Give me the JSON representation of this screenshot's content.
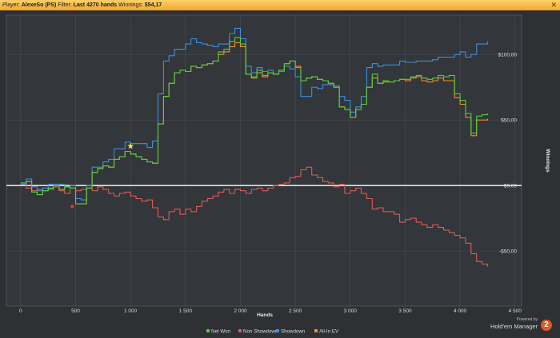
{
  "header": {
    "player_label": "Player:",
    "player_name": "AlexeSo (PS)",
    "filter_label": "Filter:",
    "filter_value": "Last 4270 hands",
    "winnings_label": "Winnings:",
    "winnings_value": "$54,17",
    "close_glyph": "✕"
  },
  "brand": {
    "powered_by": "Powered by",
    "name": "Hold'em Manager",
    "version": "2"
  },
  "chart_data": {
    "type": "line",
    "xlabel": "Hands",
    "ylabel": "Winnings",
    "xlim": [
      -130,
      4560
    ],
    "ylim": [
      -92,
      130
    ],
    "x_ticks": [
      0,
      500,
      1000,
      1500,
      2000,
      2500,
      3000,
      3500,
      4000,
      4500
    ],
    "x_tick_labels": [
      "0",
      "500",
      "1 000",
      "1 500",
      "2 000",
      "2 500",
      "3 000",
      "3 500",
      "4 000",
      "4 500"
    ],
    "y_ticks": [
      -50,
      0,
      50,
      100
    ],
    "y_tick_labels": [
      "-$50,00",
      "$0,00",
      "$50,00",
      "$100,00"
    ],
    "grid": true,
    "legend_position": "bottom",
    "zero_line": true,
    "series": [
      {
        "name": "Net Won",
        "color": "#4fd13a",
        "x": [
          0,
          50,
          100,
          150,
          200,
          250,
          300,
          350,
          400,
          450,
          500,
          550,
          600,
          650,
          700,
          750,
          800,
          850,
          900,
          950,
          1000,
          1050,
          1100,
          1150,
          1200,
          1250,
          1300,
          1350,
          1400,
          1450,
          1500,
          1550,
          1600,
          1650,
          1700,
          1750,
          1800,
          1850,
          1900,
          1950,
          2000,
          2050,
          2100,
          2150,
          2200,
          2250,
          2300,
          2350,
          2400,
          2450,
          2500,
          2550,
          2600,
          2650,
          2700,
          2750,
          2800,
          2850,
          2900,
          2950,
          3000,
          3050,
          3100,
          3150,
          3200,
          3250,
          3300,
          3350,
          3400,
          3450,
          3500,
          3550,
          3600,
          3650,
          3700,
          3750,
          3800,
          3850,
          3900,
          3950,
          4000,
          4050,
          4100,
          4150,
          4200,
          4250
        ],
        "y": [
          2,
          3,
          -5,
          -7,
          -4,
          -2,
          0,
          -3,
          -1,
          -2,
          -14,
          -14,
          -2,
          10,
          13,
          15,
          14,
          20,
          22,
          26,
          24,
          22,
          20,
          18,
          17,
          47,
          68,
          78,
          86,
          88,
          87,
          91,
          90,
          92,
          93,
          95,
          102,
          104,
          110,
          113,
          108,
          85,
          83,
          88,
          84,
          86,
          85,
          88,
          93,
          95,
          90,
          80,
          82,
          83,
          81,
          80,
          78,
          75,
          60,
          58,
          52,
          58,
          62,
          75,
          85,
          78,
          80,
          79,
          80,
          81,
          81,
          83,
          84,
          82,
          81,
          82,
          84,
          83,
          84,
          70,
          65,
          55,
          40,
          53,
          54,
          55
        ]
      },
      {
        "name": "Non Showdown",
        "color": "#e05a57",
        "x": [
          0,
          50,
          100,
          150,
          200,
          250,
          300,
          350,
          400,
          450,
          500,
          550,
          600,
          650,
          700,
          750,
          800,
          850,
          900,
          950,
          1000,
          1050,
          1100,
          1150,
          1200,
          1250,
          1300,
          1350,
          1400,
          1450,
          1500,
          1550,
          1600,
          1650,
          1700,
          1750,
          1800,
          1850,
          1900,
          1950,
          2000,
          2050,
          2100,
          2150,
          2200,
          2250,
          2300,
          2350,
          2400,
          2450,
          2500,
          2550,
          2600,
          2650,
          2700,
          2750,
          2800,
          2850,
          2900,
          2950,
          3000,
          3050,
          3100,
          3150,
          3200,
          3250,
          3300,
          3350,
          3400,
          3450,
          3500,
          3550,
          3600,
          3650,
          3700,
          3750,
          3800,
          3850,
          3900,
          3950,
          4000,
          4050,
          4100,
          4150,
          4200,
          4250
        ],
        "y": [
          1,
          -2,
          -4,
          -3,
          -2,
          -3,
          -1,
          -4,
          -6,
          -2,
          -4,
          -3,
          -2,
          -4,
          -1,
          -3,
          -6,
          -8,
          -6,
          -5,
          -8,
          -10,
          -12,
          -11,
          -17,
          -24,
          -26,
          -20,
          -18,
          -22,
          -18,
          -20,
          -16,
          -12,
          -10,
          -8,
          -5,
          -3,
          -6,
          -3,
          -4,
          -6,
          -3,
          -2,
          -4,
          -2,
          0,
          1,
          2,
          6,
          7,
          12,
          14,
          8,
          6,
          3,
          2,
          -1,
          1,
          -6,
          -4,
          -2,
          -6,
          -10,
          -18,
          -17,
          -20,
          -20,
          -22,
          -28,
          -26,
          -25,
          -28,
          -30,
          -32,
          -30,
          -32,
          -34,
          -36,
          -38,
          -40,
          -44,
          -52,
          -58,
          -60,
          -62
        ]
      },
      {
        "name": "Showdown",
        "color": "#3d8fe0",
        "x": [
          0,
          50,
          100,
          150,
          200,
          250,
          300,
          350,
          400,
          450,
          500,
          550,
          600,
          650,
          700,
          750,
          800,
          850,
          900,
          950,
          1000,
          1050,
          1100,
          1150,
          1200,
          1250,
          1300,
          1350,
          1400,
          1450,
          1500,
          1550,
          1600,
          1650,
          1700,
          1750,
          1800,
          1850,
          1900,
          1950,
          2000,
          2050,
          2100,
          2150,
          2200,
          2250,
          2300,
          2350,
          2400,
          2450,
          2500,
          2550,
          2600,
          2650,
          2700,
          2750,
          2800,
          2850,
          2900,
          2950,
          3000,
          3050,
          3100,
          3150,
          3200,
          3250,
          3300,
          3350,
          3400,
          3450,
          3500,
          3550,
          3600,
          3650,
          3700,
          3750,
          3800,
          3850,
          3900,
          3950,
          4000,
          4050,
          4100,
          4150,
          4200,
          4250
        ],
        "y": [
          1,
          5,
          -1,
          -4,
          -2,
          1,
          1,
          1,
          -1,
          0,
          -10,
          -11,
          0,
          14,
          14,
          18,
          20,
          28,
          28,
          33,
          32,
          32,
          32,
          29,
          34,
          70,
          95,
          99,
          104,
          104,
          108,
          112,
          109,
          108,
          107,
          106,
          108,
          108,
          116,
          120,
          112,
          91,
          86,
          90,
          87,
          88,
          85,
          87,
          91,
          89,
          83,
          68,
          68,
          75,
          74,
          77,
          77,
          76,
          68,
          65,
          56,
          60,
          68,
          90,
          93,
          91,
          92,
          92,
          92,
          95,
          94,
          94,
          95,
          95,
          95,
          96,
          98,
          98,
          98,
          100,
          102,
          98,
          100,
          108,
          108,
          110
        ]
      },
      {
        "name": "All-In EV",
        "color": "#f5902c",
        "x": [
          0,
          50,
          100,
          150,
          200,
          250,
          300,
          350,
          400,
          450,
          500,
          550,
          600,
          650,
          700,
          750,
          800,
          850,
          900,
          950,
          1000,
          1050,
          1100,
          1150,
          1200,
          1250,
          1300,
          1350,
          1400,
          1450,
          1500,
          1550,
          1600,
          1650,
          1700,
          1750,
          1800,
          1850,
          1900,
          1950,
          2000,
          2050,
          2100,
          2150,
          2200,
          2250,
          2300,
          2350,
          2400,
          2450,
          2500,
          2550,
          2600,
          2650,
          2700,
          2750,
          2800,
          2850,
          2900,
          2950,
          3000,
          3050,
          3100,
          3150,
          3200,
          3250,
          3300,
          3350,
          3400,
          3450,
          3500,
          3550,
          3600,
          3650,
          3700,
          3750,
          3800,
          3850,
          3900,
          3950,
          4000,
          4050,
          4100,
          4150,
          4200,
          4250
        ],
        "y": [
          2,
          3,
          -5,
          -7,
          -4,
          -2,
          0,
          -3,
          -1,
          -2,
          -14,
          -14,
          -2,
          10,
          13,
          15,
          14,
          20,
          22,
          26,
          24,
          22,
          20,
          18,
          17,
          47,
          68,
          78,
          86,
          88,
          87,
          91,
          90,
          92,
          93,
          95,
          100,
          102,
          106,
          109,
          106,
          85,
          82,
          86,
          83,
          86,
          85,
          88,
          93,
          95,
          91,
          80,
          82,
          83,
          81,
          80,
          78,
          75,
          60,
          58,
          52,
          58,
          62,
          75,
          82,
          78,
          79,
          79,
          80,
          81,
          80,
          82,
          83,
          80,
          79,
          80,
          82,
          80,
          80,
          67,
          62,
          52,
          38,
          50,
          50,
          51
        ]
      }
    ],
    "markers": [
      {
        "shape": "star",
        "x": 1000,
        "y": 30,
        "color": "#f5e23b"
      },
      {
        "shape": "dot",
        "x": 470,
        "y": -16,
        "color": "#e0322c"
      }
    ]
  }
}
